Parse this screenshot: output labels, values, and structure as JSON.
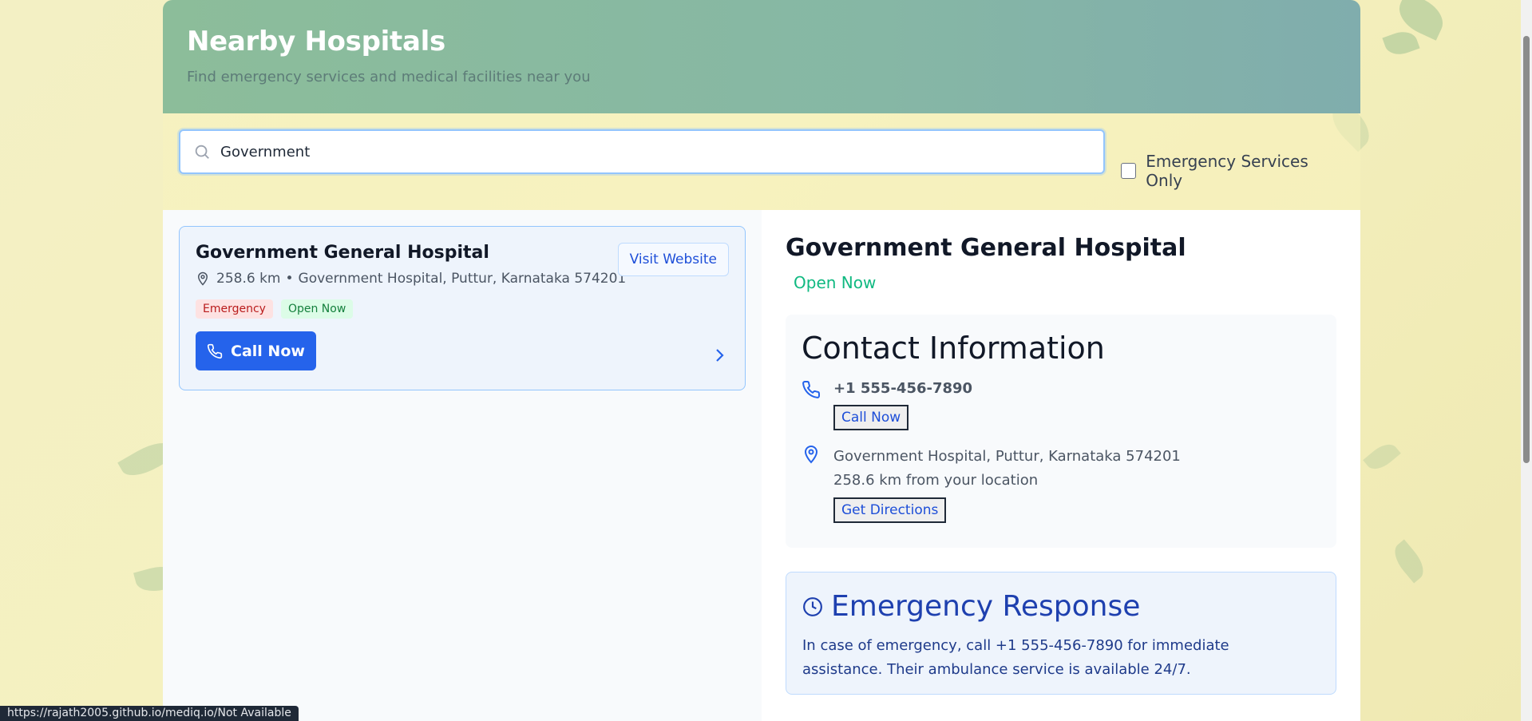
{
  "header": {
    "title": "Nearby Hospitals",
    "subtitle": "Find emergency services and medical facilities near you"
  },
  "search": {
    "value": "Government",
    "icon": "search-icon"
  },
  "filter": {
    "label": "Emergency Services Only",
    "checked": false
  },
  "hospital_list": [
    {
      "name": "Government General Hospital",
      "distance": "258.6 km",
      "separator": "•",
      "address": "Government Hospital, Puttur, Karnataka 574201",
      "visit_label": "Visit Website",
      "badges": [
        "Emergency",
        "Open Now"
      ],
      "call_label": "Call Now"
    }
  ],
  "detail": {
    "name": "Government General Hospital",
    "status": "Open Now",
    "contact": {
      "title": "Contact Information",
      "phone": "+1 555-456-7890",
      "call_label": "Call Now",
      "address": "Government Hospital, Puttur, Karnataka 574201",
      "distance_text": "258.6 km from your location",
      "directions_label": "Get Directions"
    },
    "emergency": {
      "title": "Emergency Response",
      "text": "In case of emergency, call +1 555-456-7890 for immediate assistance. Their ambulance service is available 24/7."
    }
  },
  "statusbar": {
    "url": "https://rajath2005.github.io/mediq.io/Not Available"
  },
  "colors": {
    "accent": "#2563eb",
    "open_green": "#10b981",
    "emergency_red": "#b91c1c"
  }
}
